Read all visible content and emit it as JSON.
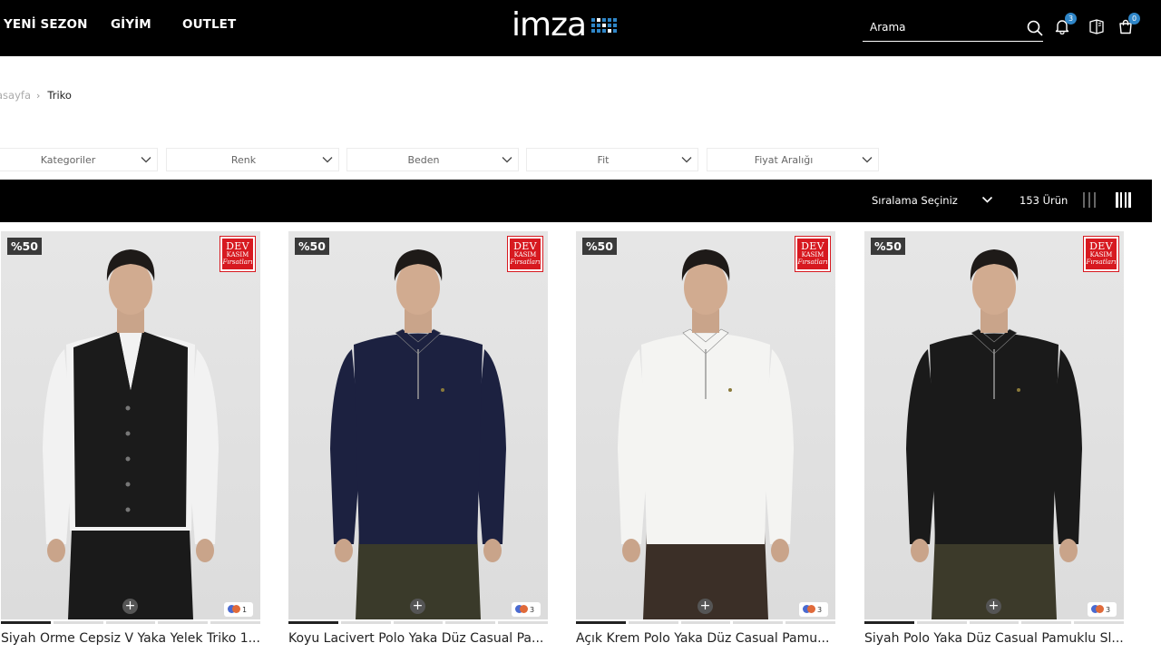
{
  "header": {
    "nav": [
      "YENİ SEZON",
      "GİYİM",
      "OUTLET"
    ],
    "logo_text": "imza",
    "search_placeholder": "Arama",
    "notification_count": "3",
    "cart_count": "0"
  },
  "breadcrumb": {
    "home": "asayfa",
    "current": "Triko"
  },
  "filters": [
    "Kategoriler",
    "Renk",
    "Beden",
    "Fit",
    "Fiyat Aralığı"
  ],
  "sortbar": {
    "sort_label": "Sıralama Seçiniz",
    "count": "153 Ürün"
  },
  "badge_text": {
    "line1": "DEV",
    "line2": "KASIM",
    "line3": "Fırsatları"
  },
  "products": [
    {
      "name": "Siyah Örme Cepsiz V Yaka Yelek Triko 1...",
      "discount": "%50",
      "colors": "1",
      "price": "",
      "top_color": "#1b1b1b",
      "shirt": "#f2f2f2",
      "pants": "#1a1a1a",
      "type": "vest"
    },
    {
      "name": "Koyu Lacivert Polo Yaka Düz Casual Pa...",
      "discount": "%50",
      "colors": "3",
      "price": "",
      "top_color": "#1c2140",
      "shirt": "",
      "pants": "#3a3a2a",
      "type": "polo"
    },
    {
      "name": "Açık Krem Polo Yaka Düz Casual Pamu...",
      "discount": "%50",
      "colors": "3",
      "price": "",
      "top_color": "#f4f4f2",
      "shirt": "",
      "pants": "#3b2f27",
      "type": "polo"
    },
    {
      "name": "Siyah Polo Yaka Düz Casual Pamuklu Sl...",
      "discount": "%50",
      "colors": "3",
      "price": "",
      "top_color": "#1a1a1a",
      "shirt": "",
      "pants": "#3c3a2a",
      "type": "polo"
    }
  ],
  "colors": {
    "accent": "#2f86c8",
    "header_bg": "#000000",
    "badge_red": "#d71920"
  }
}
